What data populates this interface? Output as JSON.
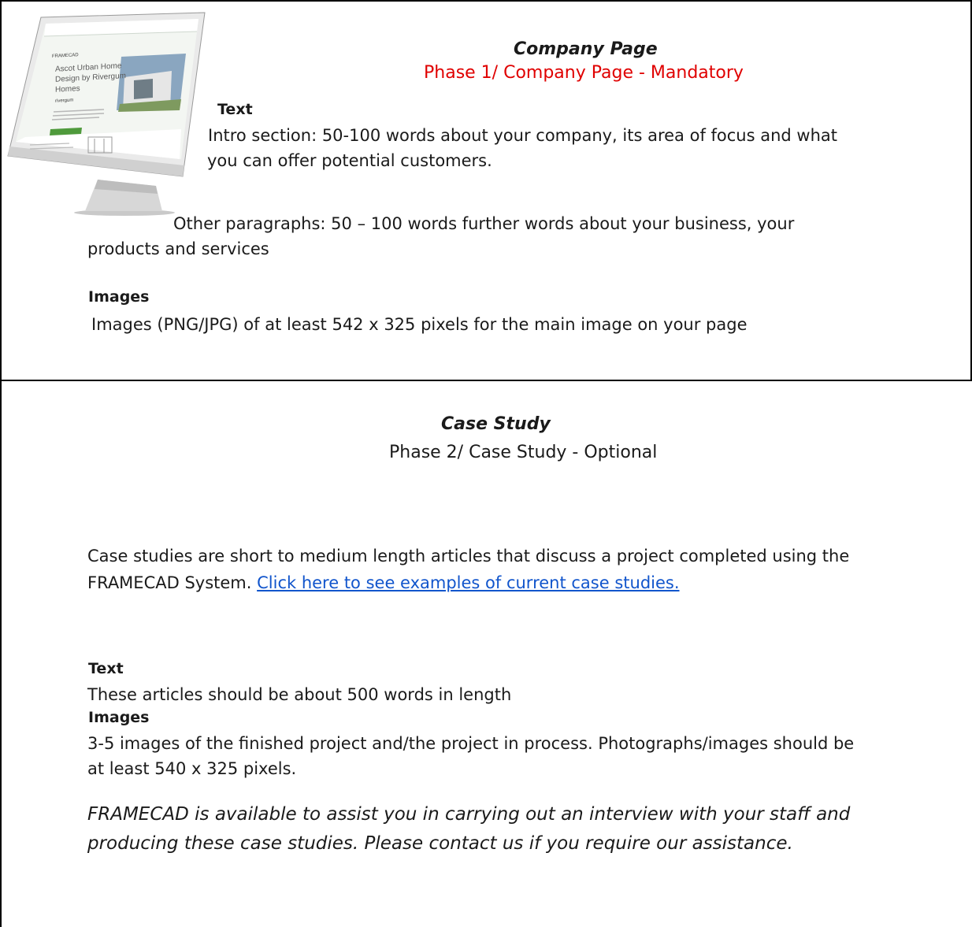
{
  "company_page": {
    "title": "Company Page",
    "subtitle": "Phase 1/ Company Page - Mandatory",
    "text_heading": "Text",
    "intro_line1": "Intro section: 50-100 words about your company, its area of focus and what",
    "intro_line2": "you can offer potential customers.",
    "other_line1": "Other paragraphs: 50 – 100 words further words about your business, your",
    "other_line2": "products and services",
    "images_heading": "Images",
    "images_text": "Images (PNG/JPG) of at least 542 x 325 pixels for the main image on your page"
  },
  "monitor_screen": {
    "logo": "FRAMECAD",
    "headline_1": "Ascot Urban Home",
    "headline_2": "Design by Rivergum",
    "headline_3": "Homes",
    "brand": "rivergum"
  },
  "case_study": {
    "title": "Case Study",
    "subtitle": "Phase 2/ Case Study - Optional",
    "desc_line1": "Case studies are short to medium length articles that discuss a project completed using the",
    "desc_line2_prefix": "FRAMECAD System. ",
    "desc_link": "Click here to see examples of current case studies.",
    "text_heading": "Text",
    "text_body": "These articles should be about 500 words in length",
    "images_heading": "Images",
    "images_line1": "3-5 images of the finished project and/the project in process. Photographs/images should be",
    "images_line2": "at least 540 x 325 pixels.",
    "note_line1": "FRAMECAD is available to assist you in carrying out an interview with your staff and",
    "note_line2": "producing these case studies. Please contact us if you require our assistance."
  }
}
